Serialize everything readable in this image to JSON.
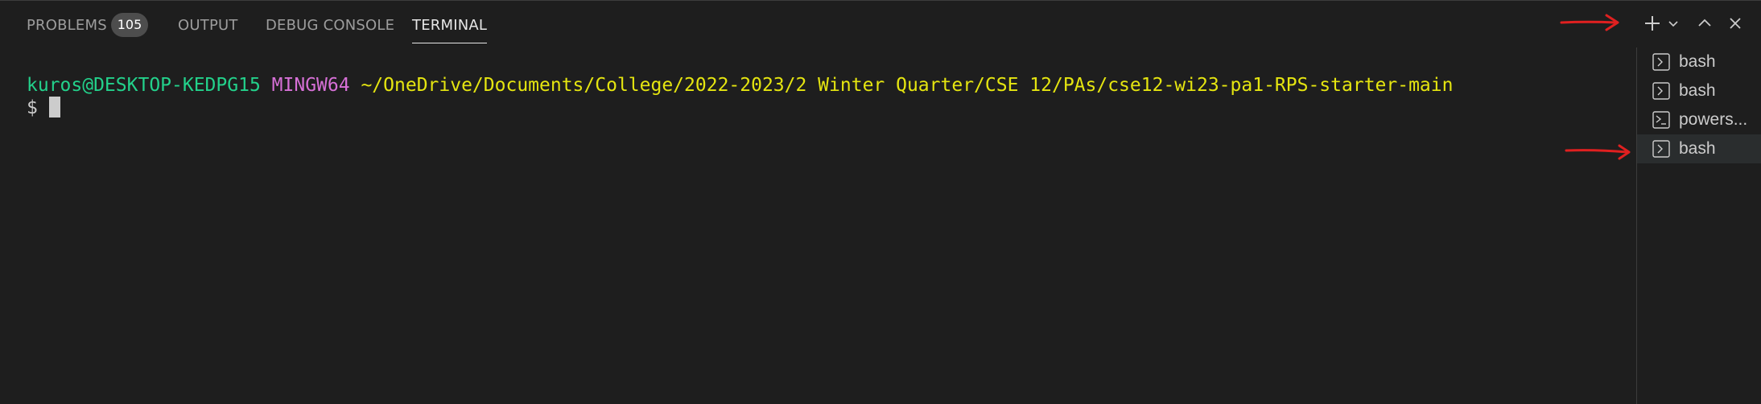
{
  "tabs": [
    {
      "label": "PROBLEMS",
      "badge": "105"
    },
    {
      "label": "OUTPUT"
    },
    {
      "label": "DEBUG CONSOLE"
    },
    {
      "label": "TERMINAL"
    }
  ],
  "terminal": {
    "user_host": "kuros@DESKTOP-KEDPG15",
    "env": "MINGW64",
    "path": "~/OneDrive/Documents/College/2022-2023/2 Winter Quarter/CSE 12/PAs/cse12-wi23-pa1-RPS-starter-main",
    "prompt": "$"
  },
  "terminal_list": [
    {
      "label": "bash",
      "icon": "terminal-icon"
    },
    {
      "label": "bash",
      "icon": "terminal-icon"
    },
    {
      "label": "powers...",
      "icon": "powershell-icon"
    },
    {
      "label": "bash",
      "icon": "terminal-icon",
      "selected": true
    }
  ],
  "annotation_color": "#e02020",
  "colors": {
    "background": "#1e1e1e",
    "user_host": "#23d18b",
    "env": "#d670d6",
    "path": "#e5e510"
  }
}
